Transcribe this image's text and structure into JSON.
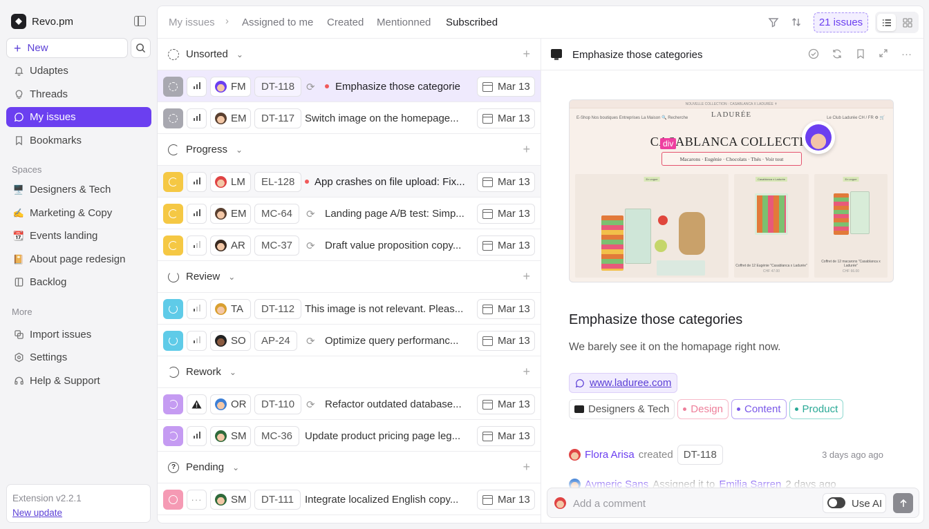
{
  "app": {
    "name": "Revo.pm"
  },
  "sidebar": {
    "new_label": "New",
    "nav": [
      {
        "label": "Udaptes",
        "icon": "bell-icon"
      },
      {
        "label": "Threads",
        "icon": "bulb-icon"
      },
      {
        "label": "My issues",
        "icon": "chat-icon",
        "active": true
      },
      {
        "label": "Bookmarks",
        "icon": "bookmark-icon"
      }
    ],
    "spaces_label": "Spaces",
    "spaces": [
      {
        "label": "Designers & Tech",
        "icon": "monitor-icon"
      },
      {
        "label": "Marketing & Copy",
        "icon": "writing-hand-icon"
      },
      {
        "label": "Events landing",
        "icon": "calendar-icon"
      },
      {
        "label": "About page redesign",
        "icon": "book-icon"
      },
      {
        "label": "Backlog",
        "icon": "backlog-icon"
      }
    ],
    "more_label": "More",
    "more": [
      {
        "label": "Import issues",
        "icon": "import-icon"
      },
      {
        "label": "Settings",
        "icon": "gear-icon"
      },
      {
        "label": "Help & Support",
        "icon": "headset-icon"
      }
    ],
    "extension": {
      "version": "Extension v2.2.1",
      "update": "New update"
    }
  },
  "topbar": {
    "crumbs": [
      "My issues",
      "Assigned to me",
      "Created",
      "Mentionned",
      "Subscribed"
    ],
    "issues_count": "21 issues"
  },
  "groups": [
    {
      "label": "Unsorted"
    },
    {
      "label": "Progress"
    },
    {
      "label": "Review"
    },
    {
      "label": "Rework"
    },
    {
      "label": "Pending"
    }
  ],
  "rows": [
    {
      "initials": "FM",
      "id": "DT-118",
      "title": "Emphasize those categorie",
      "date": "Mar 13"
    },
    {
      "initials": "EM",
      "id": "DT-117",
      "title": "Switch image on the homepage...",
      "date": "Mar 13"
    },
    {
      "initials": "LM",
      "id": "EL-128",
      "title": "App crashes on file upload: Fix...",
      "date": "Mar 13"
    },
    {
      "initials": "EM",
      "id": "MC-64",
      "title": "Landing page A/B test: Simp...",
      "date": "Mar 13"
    },
    {
      "initials": "AR",
      "id": "MC-37",
      "title": "Draft value proposition copy...",
      "date": "Mar 13"
    },
    {
      "initials": "TA",
      "id": "DT-112",
      "title": "This image is not relevant. Pleas...",
      "date": "Mar 13"
    },
    {
      "initials": "SO",
      "id": "AP-24",
      "title": "Optimize query performanc...",
      "date": "Mar 13"
    },
    {
      "initials": "OR",
      "id": "DT-110",
      "title": "Refactor outdated database...",
      "date": "Mar 13"
    },
    {
      "initials": "SM",
      "id": "MC-36",
      "title": "Update product pricing page leg...",
      "date": "Mar 13"
    },
    {
      "initials": "SM",
      "id": "DT-111",
      "title": "Integrate localized English copy...",
      "date": "Mar 13"
    }
  ],
  "detail": {
    "header_title": "Emphasize those categories",
    "title": "Emphasize those categories",
    "description": "We barely see it on the homapage right now.",
    "link": "www.laduree.com",
    "space_chip": "Designers & Tech",
    "tags": [
      "Design",
      "Content",
      "Product"
    ],
    "activity1": {
      "who": "Flora Arisa",
      "action": "created",
      "id": "DT-118",
      "time": "3 days ago ago"
    },
    "activity2": {
      "who": "Aymeric Sans",
      "action": "Assigned it to",
      "target": "Emilia Sarren",
      "time": "2 days ago"
    },
    "comment_placeholder": "Add a comment",
    "use_ai": "Use AI",
    "preview": {
      "top_strip": "NOUVELLE COLLECTION : CASABLANCA X LADURÉE ✝",
      "nav_left": "E-Shop   Nos boutiques   Entreprises   La Maison   🔍 Recherche",
      "nav_right": "Le Club Ladurée   CH / FR   ⚙   🛒",
      "logo": "LADURÉE",
      "headline": "CASABLANCA COLLECTIC",
      "div_tag": "div",
      "pill": "Macarons  ·  Eugénie  ·  Chocolats  ·  Thés  ·  Voir tout",
      "card_tag": "En vogue",
      "card_tag_mid": "Casablanca x Ladurée",
      "card_cap_mid": "Coffret de 12 Eugénie \"Casablanca x Ladurée\"",
      "card_price_mid": "CHF 47.00",
      "card_cap_right": "Coffret de 12 macarons \"Casablanca x Ladurée\"",
      "card_price_right": "CHF 66.00"
    }
  }
}
